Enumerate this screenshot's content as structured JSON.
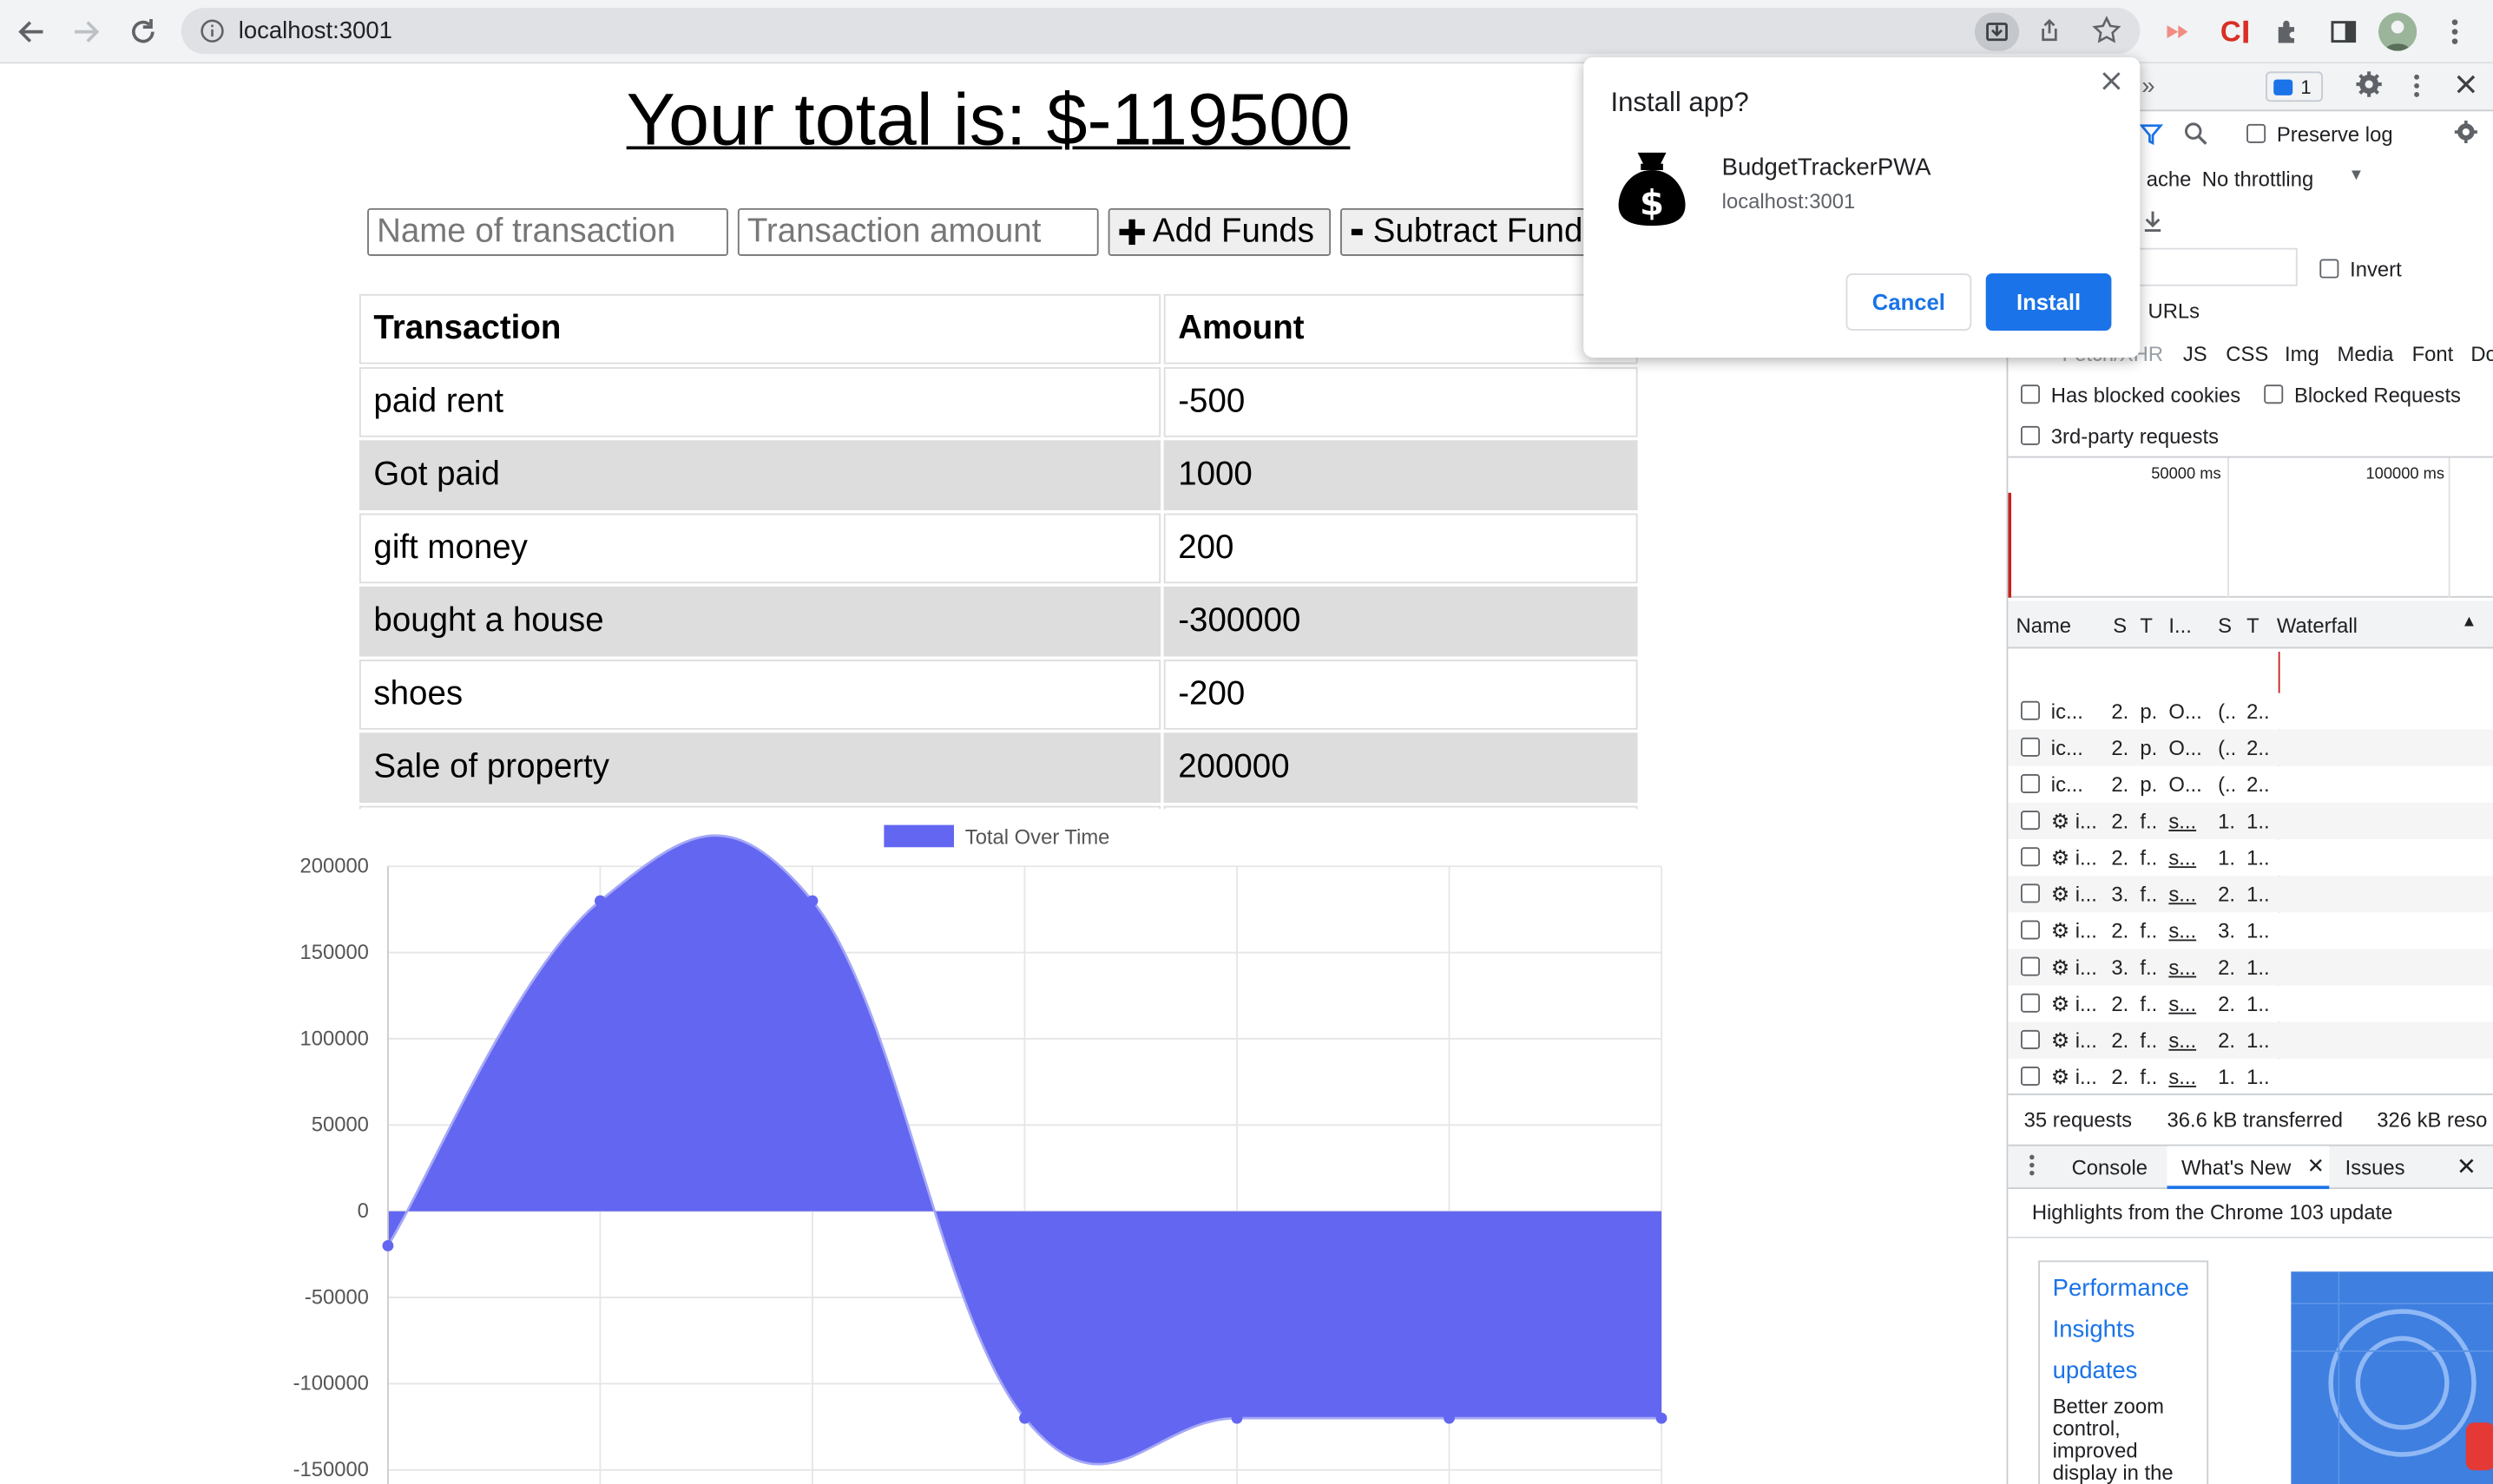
{
  "browser": {
    "url": "localhost:3001"
  },
  "page": {
    "title": "Your total is: $-119500",
    "name_placeholder": "Name of transaction",
    "amount_placeholder": "Transaction amount",
    "add_button": "Add Funds",
    "subtract_button": "Subtract Funds",
    "table_headers": [
      "Transaction",
      "Amount"
    ],
    "rows": [
      {
        "name": "paid rent",
        "amount": "-500"
      },
      {
        "name": "Got paid",
        "amount": "1000"
      },
      {
        "name": "gift money",
        "amount": "200"
      },
      {
        "name": "bought a house",
        "amount": "-300000"
      },
      {
        "name": "shoes",
        "amount": "-200"
      },
      {
        "name": "Sale of property",
        "amount": "200000"
      }
    ]
  },
  "chart_data": {
    "type": "area",
    "legend": "Total Over Time",
    "legend_position": "top",
    "color": "#6366f1",
    "ylim": [
      -150000,
      200000
    ],
    "yticks": [
      "200000",
      "150000",
      "100000",
      "50000",
      "0",
      "-50000",
      "-100000",
      "-150000"
    ],
    "values": [
      -20000,
      180000,
      180000,
      -120000,
      -120000,
      -120000,
      -120000
    ],
    "grid": true
  },
  "popup": {
    "title": "Install app?",
    "app_name": "BudgetTrackerPWA",
    "origin": "localhost:3001",
    "cancel": "Cancel",
    "install": "Install"
  },
  "devtools": {
    "issues_count": "1",
    "preserve_log": "Preserve log",
    "cache": "ache",
    "throttling": "No throttling",
    "invert": "Invert",
    "urls": "URLs",
    "filters": [
      "Fetch/XHR",
      "JS",
      "CSS",
      "Img",
      "Media",
      "Font",
      "Do"
    ],
    "has_blocked_cookies": "Has blocked cookies",
    "blocked_requests": "Blocked Requests",
    "third_party": "3rd-party requests",
    "timeline_labels": [
      "50000 ms",
      "100000 ms"
    ],
    "columns": [
      "Name",
      "S",
      "T",
      "I...",
      "S",
      "T",
      "Waterfall"
    ],
    "net_rows": [
      [
        "ic...",
        "2.",
        "p.",
        "O...",
        "(..",
        "2.."
      ],
      [
        "ic...",
        "2.",
        "p.",
        "O...",
        "(..",
        "2.."
      ],
      [
        "ic...",
        "2.",
        "p.",
        "O...",
        "(..",
        "2.."
      ],
      [
        "i...",
        "2.",
        "f..",
        "s...",
        "1.",
        "1.."
      ],
      [
        "i...",
        "2.",
        "f..",
        "s...",
        "1.",
        "1.."
      ],
      [
        "i...",
        "3.",
        "f..",
        "s...",
        "2.",
        "1.."
      ],
      [
        "i...",
        "2.",
        "f..",
        "s...",
        "3.",
        "1.."
      ],
      [
        "i...",
        "3.",
        "f..",
        "s...",
        "2.",
        "1.."
      ],
      [
        "i...",
        "2.",
        "f..",
        "s...",
        "2.",
        "1.."
      ],
      [
        "i...",
        "2.",
        "f..",
        "s...",
        "2.",
        "1.."
      ],
      [
        "i...",
        "2.",
        "f..",
        "s...",
        "1.",
        "1.."
      ]
    ],
    "summary": [
      "35 requests",
      "36.6 kB transferred",
      "326 kB reso"
    ],
    "drawer_tabs": [
      "Console",
      "What's New",
      "Issues"
    ],
    "highlights": "Highlights from the Chrome 103 update",
    "whatsnew_title": "Performance Insights updates",
    "whatsnew_body": "Better zoom control, improved display in the Details"
  }
}
